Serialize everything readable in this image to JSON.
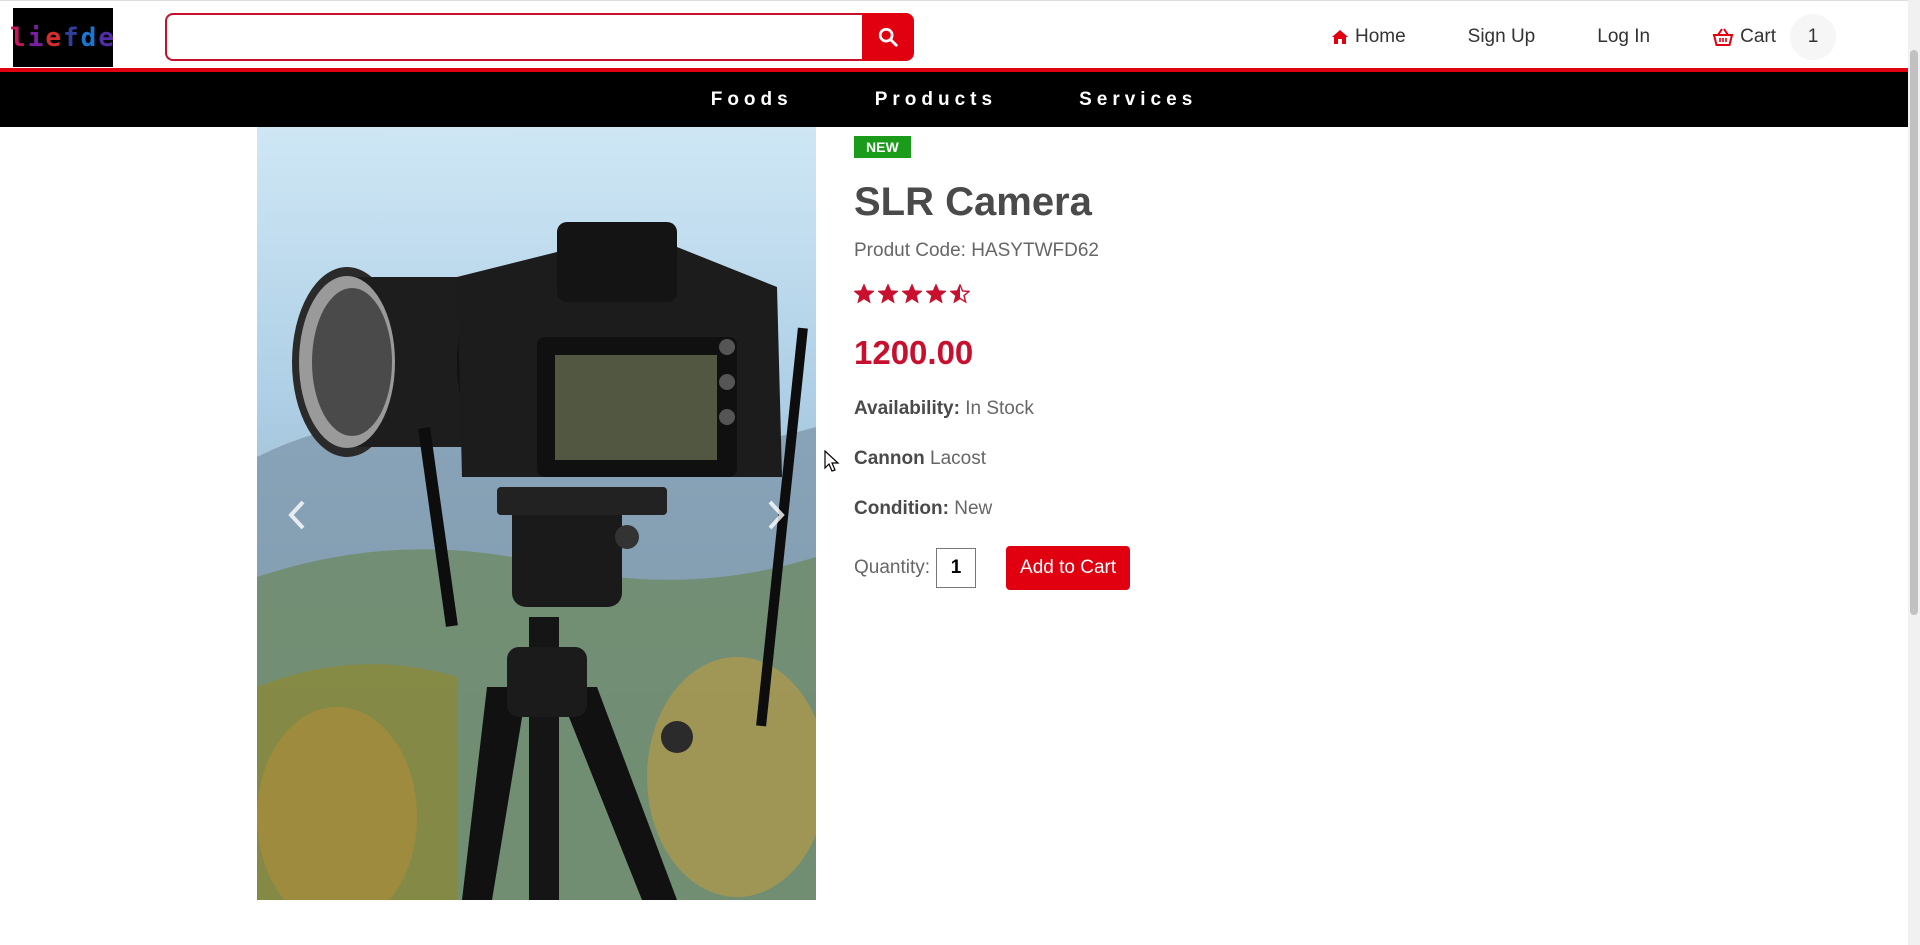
{
  "header": {
    "logo_text": "liefde",
    "search_placeholder": "",
    "nav": {
      "home": "Home",
      "signup": "Sign Up",
      "login": "Log In",
      "cart": "Cart",
      "cart_count": "1"
    }
  },
  "categories": [
    "Foods",
    "Products",
    "Services"
  ],
  "product": {
    "badge": "NEW",
    "name": "SLR Camera",
    "code": "Produt Code: HASYTWFD62",
    "rating": 4.5,
    "rating_max": 5,
    "price": "1200.00",
    "availability_label": "Availability:",
    "availability_value": "In Stock",
    "brand_label": "Cannon",
    "brand_value": "Lacost",
    "condition_label": "Condition:",
    "condition_value": "New",
    "quantity_label": "Quantity:",
    "quantity_value": "1",
    "add_to_cart": "Add to Cart"
  },
  "colors": {
    "accent": "#e0000f",
    "badge": "#1a9c1a",
    "price": "#c8102e",
    "nav_bg": "#000000"
  },
  "icons": {
    "search": "search-icon",
    "home": "home-icon",
    "cart": "basket-icon",
    "prev": "chevron-left-icon",
    "next": "chevron-right-icon"
  }
}
